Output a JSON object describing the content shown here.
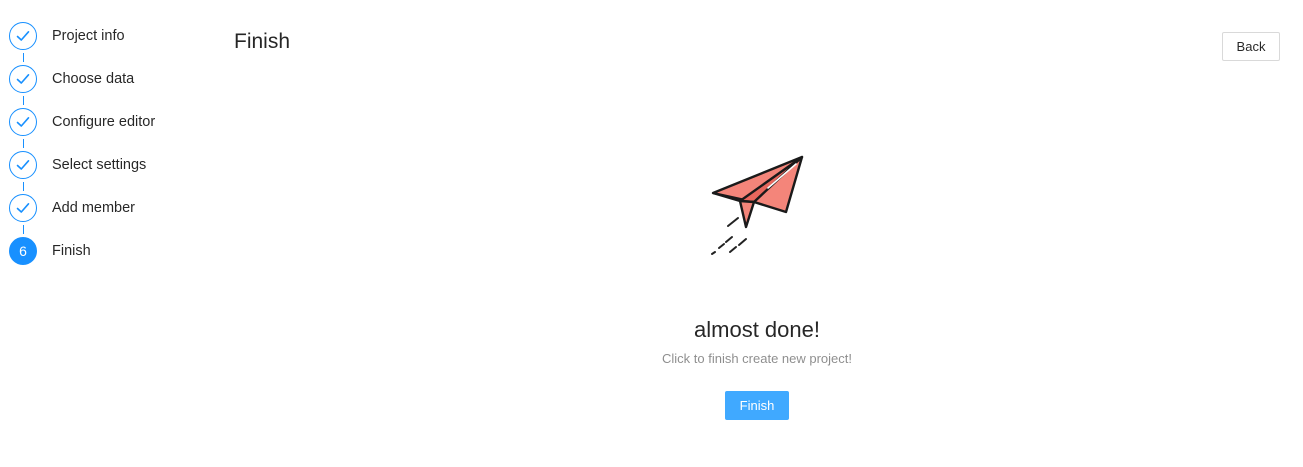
{
  "steps": [
    {
      "label": "Project info",
      "status": "done"
    },
    {
      "label": "Choose data",
      "status": "done"
    },
    {
      "label": "Configure editor",
      "status": "done"
    },
    {
      "label": "Select settings",
      "status": "done"
    },
    {
      "label": "Add member",
      "status": "done"
    },
    {
      "label": "Finish",
      "status": "active",
      "number": "6"
    }
  ],
  "header": {
    "title": "Finish",
    "back_label": "Back"
  },
  "result": {
    "icon": "paper-plane-icon",
    "title": "almost done!",
    "subtitle": "Click to finish create new project!",
    "finish_label": "Finish"
  },
  "colors": {
    "primary": "#1890ff",
    "button": "#40a9ff",
    "plane_fill": "#f4857a"
  }
}
